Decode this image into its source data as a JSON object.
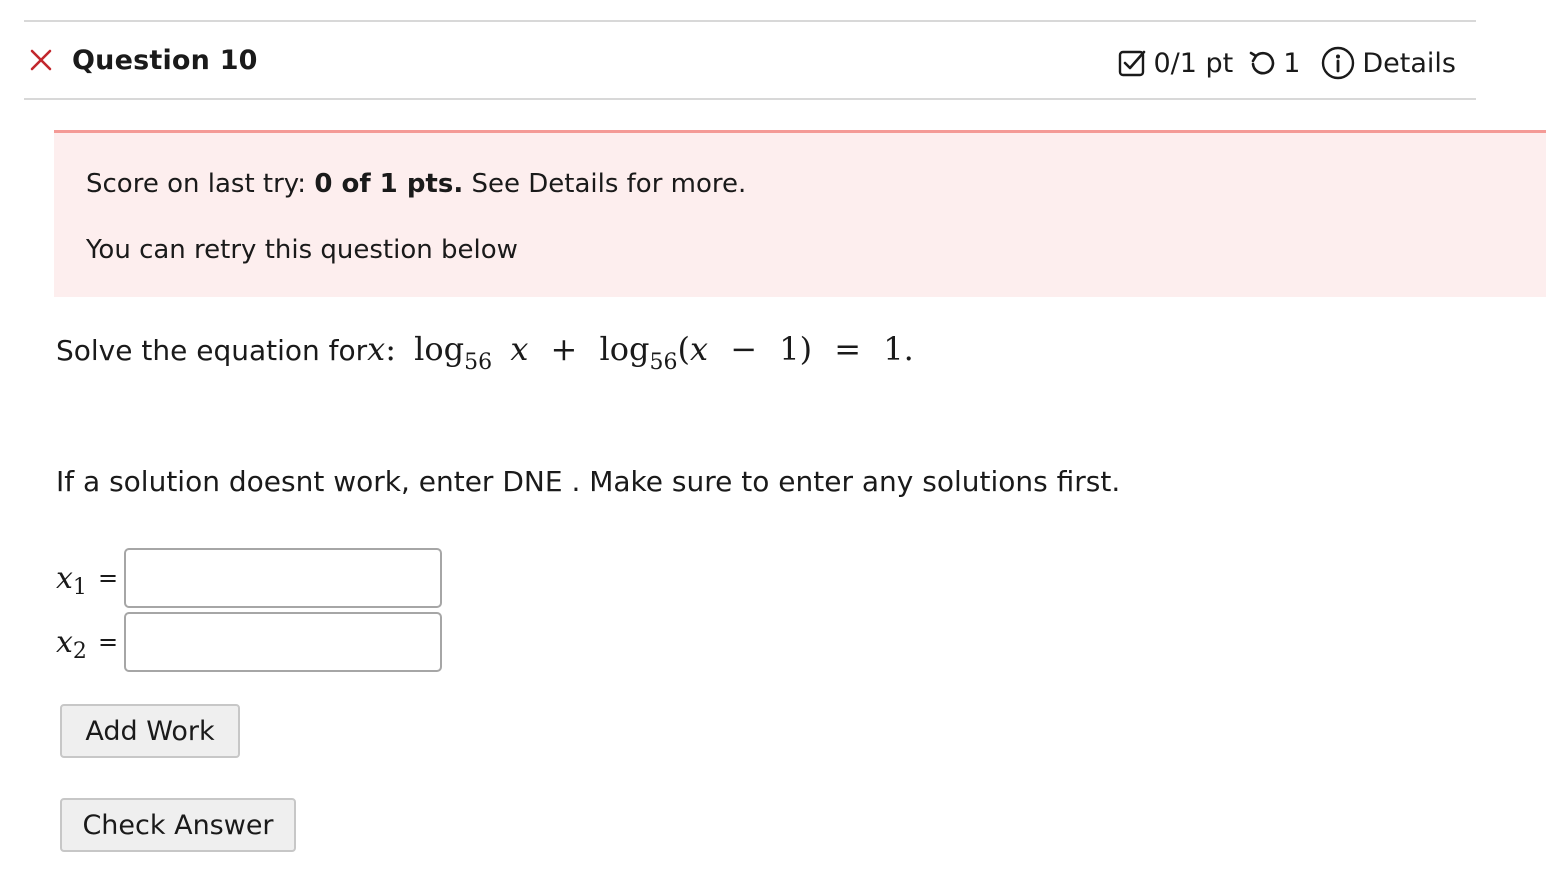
{
  "header": {
    "question_title": "Question 10",
    "score": "0/1 pt",
    "retries": "1",
    "details_label": "Details"
  },
  "alert": {
    "score_prefix": "Score on last try: ",
    "score_value": "0 of 1 pts.",
    "score_suffix": " See Details for more.",
    "retry_message": "You can retry this question below"
  },
  "question": {
    "prompt": "Solve the equation for ",
    "variable": "x",
    "colon": ":",
    "log_word": "log",
    "base": "56",
    "plus": "+",
    "lparen": "(",
    "minus": "−",
    "one": "1",
    "rparen": ")",
    "equals": "=",
    "rhs": "1."
  },
  "instructions": "If a solution doesnt work, enter DNE . Make sure to enter any solutions first.",
  "answers": [
    {
      "var": "x",
      "sub": "1",
      "eq": "=",
      "value": ""
    },
    {
      "var": "x",
      "sub": "2",
      "eq": "=",
      "value": ""
    }
  ],
  "buttons": {
    "add_work": "Add Work",
    "check_answer": "Check Answer"
  },
  "colors": {
    "incorrect_icon": "#c2272d",
    "alert_bg": "#fdeeee",
    "alert_border": "#f49a96"
  },
  "icons": [
    "close-icon",
    "score-check-icon",
    "retry-icon",
    "info-icon"
  ]
}
